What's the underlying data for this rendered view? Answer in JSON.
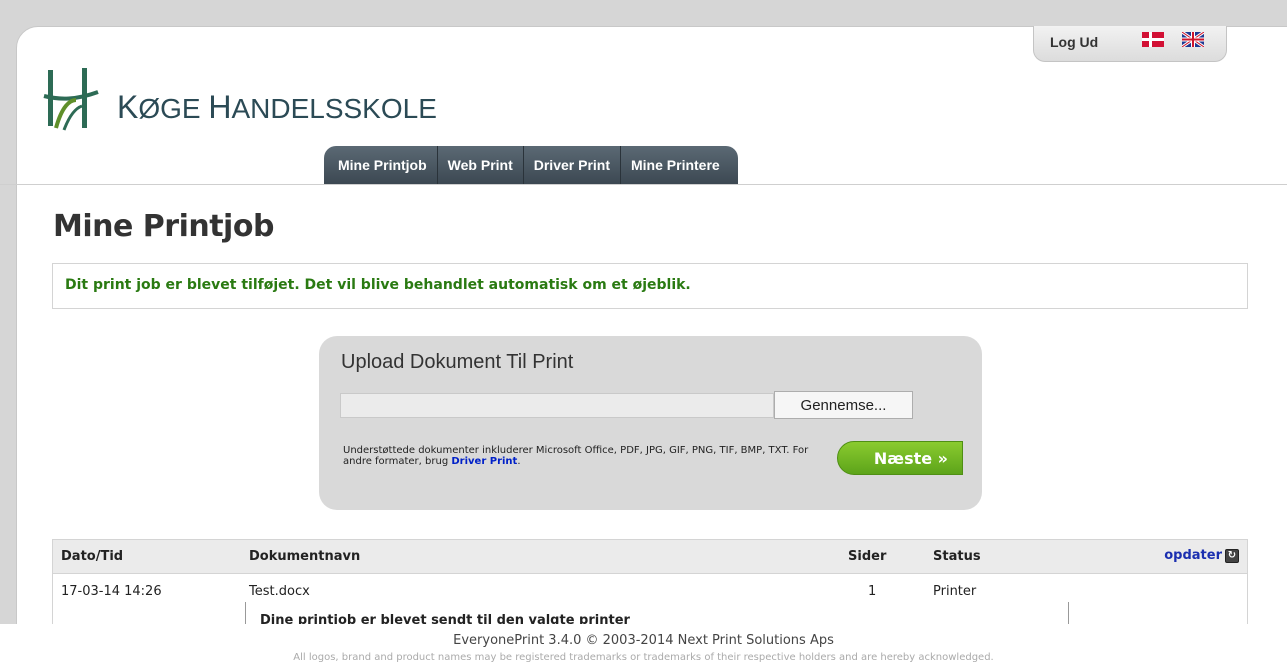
{
  "header": {
    "logout_label": "Log Ud",
    "school_name_k": "K",
    "school_name_rest1": "ØGE ",
    "school_name_h": "H",
    "school_name_rest2": "ANDELSSKOLE"
  },
  "nav": {
    "tabs": [
      {
        "label": "Mine Printjob"
      },
      {
        "label": "Web Print"
      },
      {
        "label": "Driver Print"
      },
      {
        "label": "Mine Printere"
      }
    ]
  },
  "page": {
    "title": "Mine Printjob",
    "notice": "Dit print job er blevet tilføjet. Det vil blive behandlet automatisk om et øjeblik."
  },
  "upload": {
    "title": "Upload Dokument Til Print",
    "file_value": "",
    "browse_label": "Gennemse...",
    "support_text": "Understøttede dokumenter inkluderer Microsoft Office, PDF, JPG, GIF, PNG, TIF, BMP, TXT. For andre formater, brug",
    "support_link": "Driver Print",
    "support_end": ".",
    "next_label": "Næste »"
  },
  "jobs": {
    "headers": {
      "date": "Dato/Tid",
      "document": "Dokumentnavn",
      "pages": "Sider",
      "status": "Status",
      "refresh": "opdater"
    },
    "rows": [
      {
        "date": "17-03-14 14:26",
        "document": "Test.docx",
        "pages": "1",
        "status": "Printer",
        "detail": "Dine printjob er blevet sendt til den valgte printer"
      }
    ]
  },
  "footer": {
    "copyright": "EveryonePrint 3.4.0 © 2003-2014 Next Print Solutions Aps",
    "trademark": "All logos, brand and product names may be registered trademarks or trademarks of their respective holders and are hereby acknowledged."
  },
  "colors": {
    "notice_green": "#2a7a12",
    "next_green": "#6cb521",
    "nav_dark": "#3c4852",
    "link_blue": "#1b2fb0"
  }
}
